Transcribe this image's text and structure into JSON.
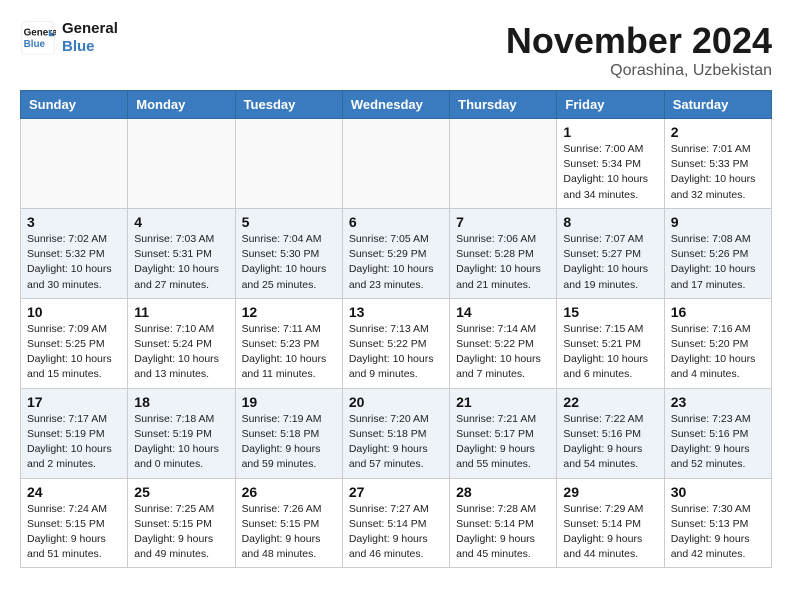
{
  "header": {
    "logo_line1": "General",
    "logo_line2": "Blue",
    "month": "November 2024",
    "location": "Qorashina, Uzbekistan"
  },
  "weekdays": [
    "Sunday",
    "Monday",
    "Tuesday",
    "Wednesday",
    "Thursday",
    "Friday",
    "Saturday"
  ],
  "weeks": [
    [
      {
        "day": "",
        "info": ""
      },
      {
        "day": "",
        "info": ""
      },
      {
        "day": "",
        "info": ""
      },
      {
        "day": "",
        "info": ""
      },
      {
        "day": "",
        "info": ""
      },
      {
        "day": "1",
        "info": "Sunrise: 7:00 AM\nSunset: 5:34 PM\nDaylight: 10 hours\nand 34 minutes."
      },
      {
        "day": "2",
        "info": "Sunrise: 7:01 AM\nSunset: 5:33 PM\nDaylight: 10 hours\nand 32 minutes."
      }
    ],
    [
      {
        "day": "3",
        "info": "Sunrise: 7:02 AM\nSunset: 5:32 PM\nDaylight: 10 hours\nand 30 minutes."
      },
      {
        "day": "4",
        "info": "Sunrise: 7:03 AM\nSunset: 5:31 PM\nDaylight: 10 hours\nand 27 minutes."
      },
      {
        "day": "5",
        "info": "Sunrise: 7:04 AM\nSunset: 5:30 PM\nDaylight: 10 hours\nand 25 minutes."
      },
      {
        "day": "6",
        "info": "Sunrise: 7:05 AM\nSunset: 5:29 PM\nDaylight: 10 hours\nand 23 minutes."
      },
      {
        "day": "7",
        "info": "Sunrise: 7:06 AM\nSunset: 5:28 PM\nDaylight: 10 hours\nand 21 minutes."
      },
      {
        "day": "8",
        "info": "Sunrise: 7:07 AM\nSunset: 5:27 PM\nDaylight: 10 hours\nand 19 minutes."
      },
      {
        "day": "9",
        "info": "Sunrise: 7:08 AM\nSunset: 5:26 PM\nDaylight: 10 hours\nand 17 minutes."
      }
    ],
    [
      {
        "day": "10",
        "info": "Sunrise: 7:09 AM\nSunset: 5:25 PM\nDaylight: 10 hours\nand 15 minutes."
      },
      {
        "day": "11",
        "info": "Sunrise: 7:10 AM\nSunset: 5:24 PM\nDaylight: 10 hours\nand 13 minutes."
      },
      {
        "day": "12",
        "info": "Sunrise: 7:11 AM\nSunset: 5:23 PM\nDaylight: 10 hours\nand 11 minutes."
      },
      {
        "day": "13",
        "info": "Sunrise: 7:13 AM\nSunset: 5:22 PM\nDaylight: 10 hours\nand 9 minutes."
      },
      {
        "day": "14",
        "info": "Sunrise: 7:14 AM\nSunset: 5:22 PM\nDaylight: 10 hours\nand 7 minutes."
      },
      {
        "day": "15",
        "info": "Sunrise: 7:15 AM\nSunset: 5:21 PM\nDaylight: 10 hours\nand 6 minutes."
      },
      {
        "day": "16",
        "info": "Sunrise: 7:16 AM\nSunset: 5:20 PM\nDaylight: 10 hours\nand 4 minutes."
      }
    ],
    [
      {
        "day": "17",
        "info": "Sunrise: 7:17 AM\nSunset: 5:19 PM\nDaylight: 10 hours\nand 2 minutes."
      },
      {
        "day": "18",
        "info": "Sunrise: 7:18 AM\nSunset: 5:19 PM\nDaylight: 10 hours\nand 0 minutes."
      },
      {
        "day": "19",
        "info": "Sunrise: 7:19 AM\nSunset: 5:18 PM\nDaylight: 9 hours\nand 59 minutes."
      },
      {
        "day": "20",
        "info": "Sunrise: 7:20 AM\nSunset: 5:18 PM\nDaylight: 9 hours\nand 57 minutes."
      },
      {
        "day": "21",
        "info": "Sunrise: 7:21 AM\nSunset: 5:17 PM\nDaylight: 9 hours\nand 55 minutes."
      },
      {
        "day": "22",
        "info": "Sunrise: 7:22 AM\nSunset: 5:16 PM\nDaylight: 9 hours\nand 54 minutes."
      },
      {
        "day": "23",
        "info": "Sunrise: 7:23 AM\nSunset: 5:16 PM\nDaylight: 9 hours\nand 52 minutes."
      }
    ],
    [
      {
        "day": "24",
        "info": "Sunrise: 7:24 AM\nSunset: 5:15 PM\nDaylight: 9 hours\nand 51 minutes."
      },
      {
        "day": "25",
        "info": "Sunrise: 7:25 AM\nSunset: 5:15 PM\nDaylight: 9 hours\nand 49 minutes."
      },
      {
        "day": "26",
        "info": "Sunrise: 7:26 AM\nSunset: 5:15 PM\nDaylight: 9 hours\nand 48 minutes."
      },
      {
        "day": "27",
        "info": "Sunrise: 7:27 AM\nSunset: 5:14 PM\nDaylight: 9 hours\nand 46 minutes."
      },
      {
        "day": "28",
        "info": "Sunrise: 7:28 AM\nSunset: 5:14 PM\nDaylight: 9 hours\nand 45 minutes."
      },
      {
        "day": "29",
        "info": "Sunrise: 7:29 AM\nSunset: 5:14 PM\nDaylight: 9 hours\nand 44 minutes."
      },
      {
        "day": "30",
        "info": "Sunrise: 7:30 AM\nSunset: 5:13 PM\nDaylight: 9 hours\nand 42 minutes."
      }
    ]
  ]
}
